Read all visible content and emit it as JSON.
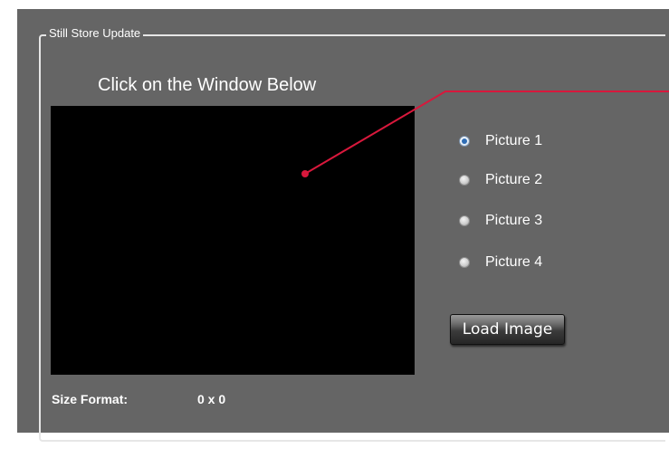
{
  "group": {
    "title": "Still Store Update"
  },
  "preview": {
    "instruction": "Click on the Window Below"
  },
  "pictures": [
    {
      "label": "Picture 1",
      "checked": true
    },
    {
      "label": "Picture 2",
      "checked": false
    },
    {
      "label": "Picture 3",
      "checked": false
    },
    {
      "label": "Picture 4",
      "checked": false
    }
  ],
  "load_button": {
    "label": "Load Image"
  },
  "size": {
    "label": "Size Format:",
    "value": "0 x 0"
  },
  "colors": {
    "background": "#656565",
    "preview": "#000000",
    "callout": "#d8183c",
    "text": "#ffffff"
  }
}
